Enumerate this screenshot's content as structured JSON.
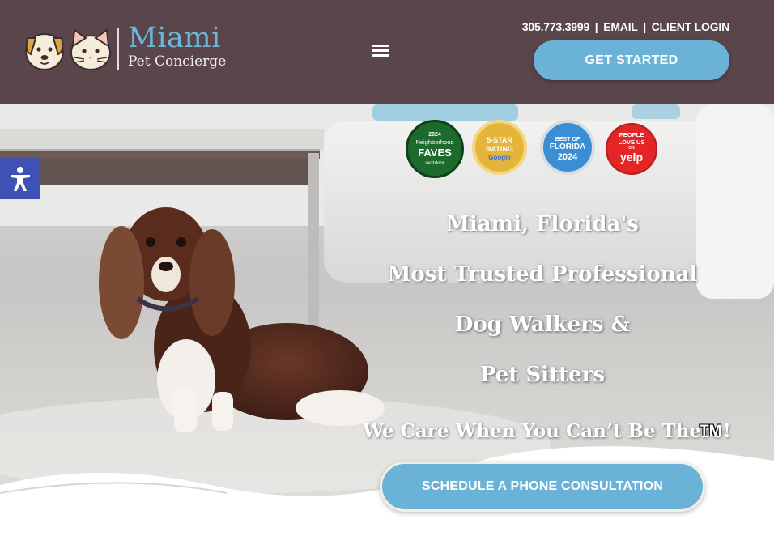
{
  "header": {
    "logo": {
      "title": "Miami",
      "subtitle": "Pet Concierge"
    },
    "menu_icon": "hamburger-menu-icon",
    "phone": "305.773.3999",
    "email_label": "EMAIL",
    "login_label": "CLIENT LOGIN",
    "separator": "|",
    "cta_label": "GET STARTED"
  },
  "colors": {
    "header_bg": "#5a454a",
    "accent_blue": "#6ab2d7",
    "accessibility_blue": "#3f51b5"
  },
  "badges": [
    {
      "name": "nextdoor-badge",
      "line1": "2024",
      "line2": "Neighborhood",
      "line3": "FAVES",
      "line4": "nextdoor"
    },
    {
      "name": "google-5-star-badge",
      "line1": "5-STAR",
      "line2": "RATING",
      "line3": "Google"
    },
    {
      "name": "best-of-florida-badge",
      "line1": "BEST OF",
      "line2": "FLORIDA",
      "line3": "2024"
    },
    {
      "name": "yelp-badge",
      "line1": "PEOPLE",
      "line2": "LOVE US",
      "line3": "ON",
      "line4": "yelp"
    }
  ],
  "hero": {
    "headline_lines": [
      "Miami, Florida's",
      "Most Trusted Professional",
      "Dog Walkers &",
      "Pet Sitters"
    ],
    "tagline": "We Care When You Can’t Be There!",
    "trademark": "TM",
    "cta_label": "SCHEDULE A PHONE CONSULTATION"
  },
  "accessibility": {
    "icon": "accessibility-icon"
  }
}
